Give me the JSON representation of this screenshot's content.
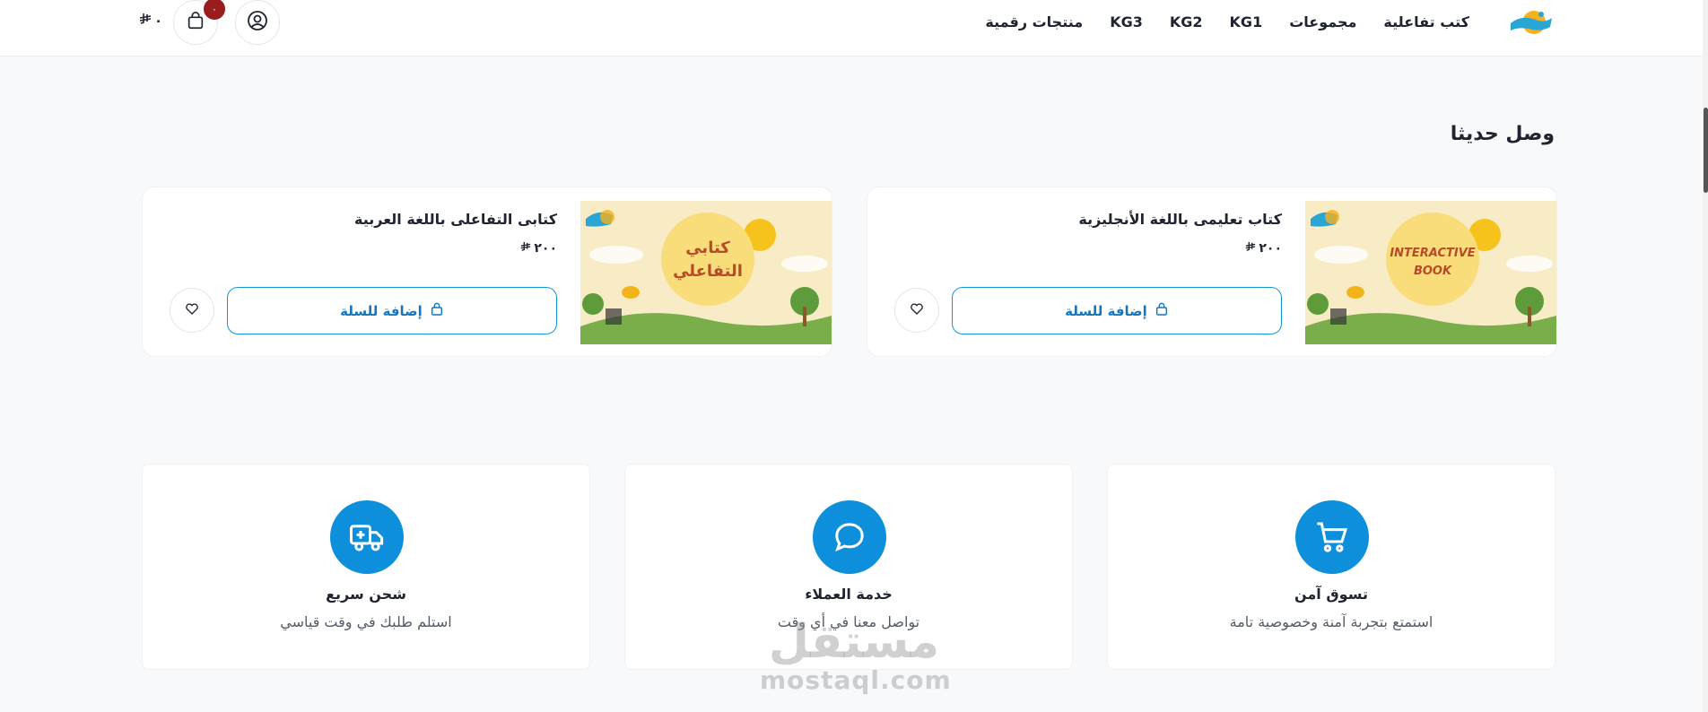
{
  "header": {
    "nav": [
      "كتب تفاعلية",
      "مجموعات",
      "KG1",
      "KG2",
      "KG3",
      "منتجات رقمية"
    ],
    "cart_count": "٠",
    "cart_total": "٠"
  },
  "section": {
    "title": "وصل حديثا"
  },
  "products": [
    {
      "name": "كتاب تعليمى باللغة الأنجليزية",
      "price": "٢٠٠",
      "add_label": "إضافة للسلة",
      "cover_text": [
        "INTERACTIVE",
        "BOOK"
      ]
    },
    {
      "name": "كتابى التفاعلى باللغة العربية",
      "price": "٢٠٠",
      "add_label": "إضافة للسلة",
      "cover_text": [
        "كتابي",
        "التفاعلي"
      ]
    }
  ],
  "features": [
    {
      "title": "تسوق آمن",
      "subtitle": "استمتع بتجربة آمنة وخصوصية تامة",
      "icon": "cart-icon"
    },
    {
      "title": "خدمة العملاء",
      "subtitle": "تواصل معنا في أي وقت",
      "icon": "chat-icon"
    },
    {
      "title": "شحن سريع",
      "subtitle": "استلم طلبك في وقت قياسي",
      "icon": "truck-icon"
    }
  ],
  "watermark": {
    "ar": "مستقل",
    "en": "mostaql.com"
  },
  "colors": {
    "accent": "#0d8fdc",
    "button_border": "#1196d9",
    "badge": "#9b1c1c"
  }
}
